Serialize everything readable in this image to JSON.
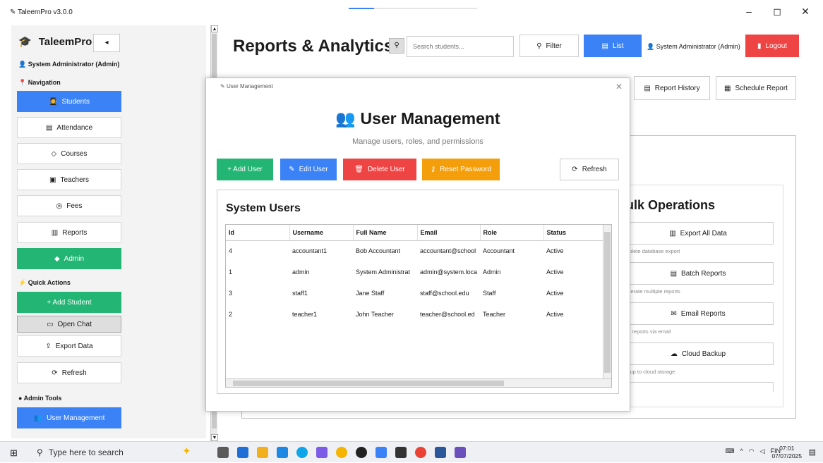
{
  "window": {
    "title": "TaleemPro v3.0.0",
    "minimize": "–",
    "maximize": "◻",
    "close": "✕"
  },
  "sidebar": {
    "brand": "TaleemPro",
    "collapse": "◂",
    "user": "System Administrator (Admin)",
    "nav_heading": "Navigation",
    "nav": [
      {
        "label": "Students",
        "icon": "students-icon"
      },
      {
        "label": "Attendance",
        "icon": "attendance-icon"
      },
      {
        "label": "Courses",
        "icon": "courses-icon"
      },
      {
        "label": "Teachers",
        "icon": "teachers-icon"
      },
      {
        "label": "Fees",
        "icon": "fees-icon"
      },
      {
        "label": "Reports",
        "icon": "reports-icon"
      },
      {
        "label": "Admin",
        "icon": "admin-icon"
      }
    ],
    "quick_heading": "Quick Actions",
    "quick": [
      {
        "label": "+ Add Student"
      },
      {
        "label": "Open Chat"
      },
      {
        "label": "Export Data"
      },
      {
        "label": "Refresh"
      }
    ],
    "admin_heading": "Admin Tools",
    "admin_tools": [
      {
        "label": "User Management"
      }
    ]
  },
  "header": {
    "title": "Reports & Analytics",
    "search_placeholder": "Search students...",
    "filter_label": "Filter",
    "list_label": "List",
    "admin_label": "System Administrator (Admin)",
    "logout_label": "Logout",
    "report_history_label": "Report History",
    "schedule_report_label": "Schedule Report"
  },
  "bulk": {
    "title": "ulk Operations",
    "items": [
      {
        "label": "Export All Data",
        "desc": "mplete database export"
      },
      {
        "label": "Batch Reports",
        "desc": "enerate multiple reports"
      },
      {
        "label": "Email Reports",
        "desc": "nd reports via email"
      },
      {
        "label": "Cloud Backup",
        "desc": "ckup to cloud storage"
      }
    ]
  },
  "dialog": {
    "window_title": "User Management",
    "heading": "User Management",
    "subtitle": "Manage users, roles, and permissions",
    "buttons": {
      "add": "+ Add User",
      "edit": "Edit User",
      "delete": "Delete User",
      "reset": "Reset Password",
      "refresh": "Refresh"
    },
    "panel_title": "System Users",
    "columns": [
      "Id",
      "Username",
      "Full Name",
      "Email",
      "Role",
      "Status"
    ],
    "rows": [
      [
        "4",
        "accountant1",
        "Bob Accountant",
        "accountant@school",
        "Accountant",
        "Active"
      ],
      [
        "1",
        "admin",
        "System Administrat",
        "admin@system.loca",
        "Admin",
        "Active"
      ],
      [
        "3",
        "staff1",
        "Jane Staff",
        "staff@school.edu",
        "Staff",
        "Active"
      ],
      [
        "2",
        "teacher1",
        "John Teacher",
        "teacher@school.ed",
        "Teacher",
        "Active"
      ]
    ]
  },
  "taskbar": {
    "search_placeholder": "Type here to search",
    "tray_lang": "FIN",
    "time": "07:01",
    "date": "07/07/2025"
  },
  "colors": {
    "blue": "#3b82f6",
    "green": "#22b573",
    "red": "#ef4444",
    "orange": "#f59e0b"
  }
}
